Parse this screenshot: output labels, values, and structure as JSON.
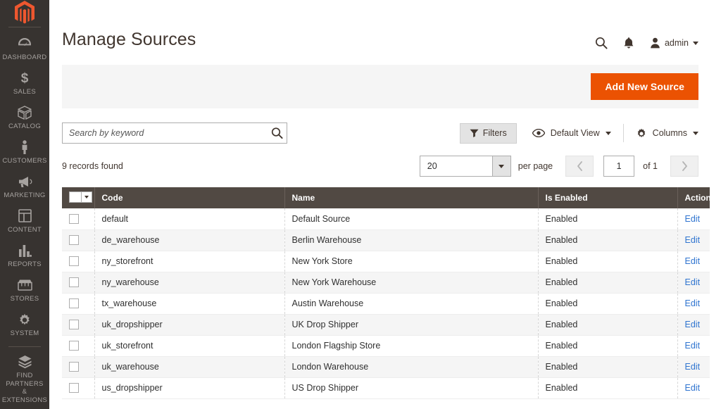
{
  "sidebar": {
    "logo_name": "magento-logo",
    "items": [
      {
        "label": "DASHBOARD",
        "icon": "dashboard-gauge-icon"
      },
      {
        "label": "SALES",
        "icon": "dollar-sign-icon"
      },
      {
        "label": "CATALOG",
        "icon": "box-icon"
      },
      {
        "label": "CUSTOMERS",
        "icon": "person-icon"
      },
      {
        "label": "MARKETING",
        "icon": "megaphone-icon"
      },
      {
        "label": "CONTENT",
        "icon": "layout-icon"
      },
      {
        "label": "REPORTS",
        "icon": "bar-chart-icon"
      },
      {
        "label": "STORES",
        "icon": "storefront-icon"
      },
      {
        "label": "SYSTEM",
        "icon": "gear-icon"
      },
      {
        "label": "FIND PARTNERS\n& EXTENSIONS",
        "icon": "extension-block-icon"
      }
    ]
  },
  "header": {
    "title": "Manage Sources",
    "search_icon": "search-icon",
    "notifications_icon": "bell-icon",
    "user_icon": "user-avatar-icon",
    "user_name": "admin"
  },
  "action_panel": {
    "add_new_source_label": "Add New Source"
  },
  "toolbar": {
    "search_placeholder": "Search by keyword",
    "search_value": "",
    "search_icon": "search-icon",
    "filters_label": "Filters",
    "filters_icon": "funnel-icon",
    "view_label": "Default View",
    "view_icon": "eye-icon",
    "columns_label": "Columns",
    "columns_icon": "gear-icon"
  },
  "records": {
    "found_text": "9 records found",
    "per_page_value": "20",
    "per_page_label": "per page",
    "page_value": "1",
    "of_text": "of 1",
    "prev_icon": "chevron-left-icon",
    "next_icon": "chevron-right-icon"
  },
  "grid": {
    "columns": [
      "Code",
      "Name",
      "Is Enabled",
      "Action"
    ],
    "rows": [
      {
        "code": "default",
        "name": "Default Source",
        "enabled": "Enabled",
        "action": "Edit"
      },
      {
        "code": "de_warehouse",
        "name": "Berlin Warehouse",
        "enabled": "Enabled",
        "action": "Edit"
      },
      {
        "code": "ny_storefront",
        "name": "New York Store",
        "enabled": "Enabled",
        "action": "Edit"
      },
      {
        "code": "ny_warehouse",
        "name": "New York Warehouse",
        "enabled": "Enabled",
        "action": "Edit"
      },
      {
        "code": "tx_warehouse",
        "name": "Austin Warehouse",
        "enabled": "Enabled",
        "action": "Edit"
      },
      {
        "code": "uk_dropshipper",
        "name": "UK Drop Shipper",
        "enabled": "Enabled",
        "action": "Edit"
      },
      {
        "code": "uk_storefront",
        "name": "London Flagship Store",
        "enabled": "Enabled",
        "action": "Edit"
      },
      {
        "code": "uk_warehouse",
        "name": "London Warehouse",
        "enabled": "Enabled",
        "action": "Edit"
      },
      {
        "code": "us_dropshipper",
        "name": "US Drop Shipper",
        "enabled": "Enabled",
        "action": "Edit"
      }
    ]
  },
  "colors": {
    "sidebar_bg": "#373330",
    "accent_orange": "#eb5202",
    "grid_header_bg": "#514943",
    "link_blue": "#2f74d0",
    "panel_grey": "#f5f5f5"
  }
}
